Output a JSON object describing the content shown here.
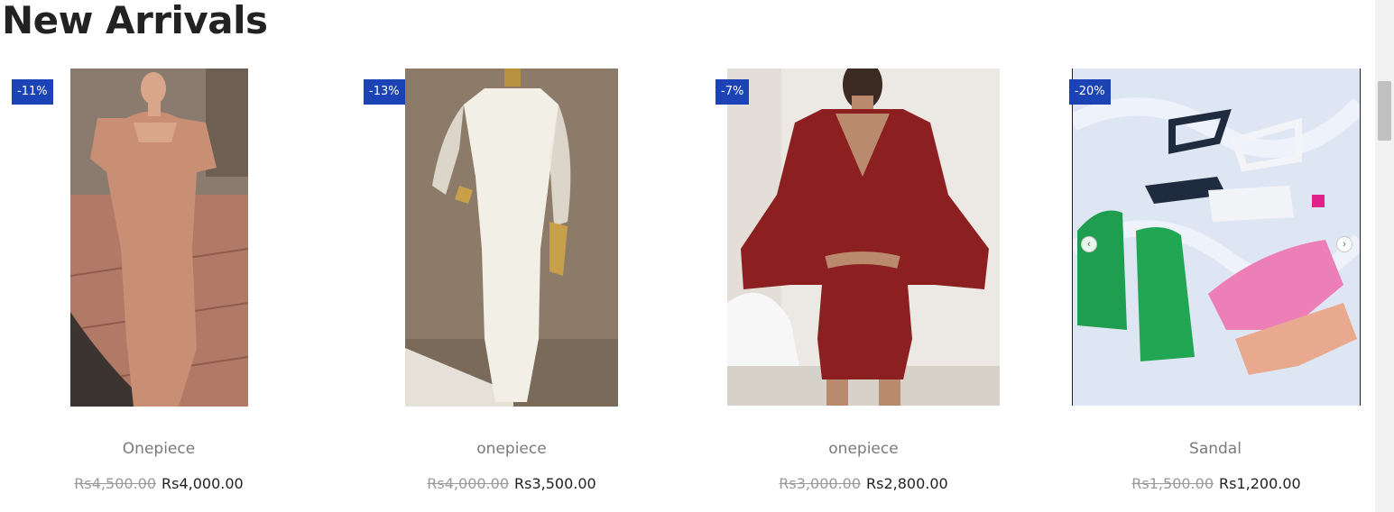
{
  "section": {
    "title": "New Arrivals"
  },
  "products": [
    {
      "name": "Onepiece",
      "discount": "-11%",
      "old_price": "Rs4,500.00",
      "new_price": "Rs4,000.00",
      "image": "satin-puff-sleeve-dress-photo"
    },
    {
      "name": "onepiece",
      "discount": "-13%",
      "old_price": "Rs4,000.00",
      "new_price": "Rs3,500.00",
      "image": "white-sheer-sleeve-dress-photo"
    },
    {
      "name": "onepiece",
      "discount": "-7%",
      "old_price": "Rs3,000.00",
      "new_price": "Rs2,800.00",
      "image": "red-wrap-dress-photo"
    },
    {
      "name": "Sandal",
      "discount": "-20%",
      "old_price": "Rs1,500.00",
      "new_price": "Rs1,200.00",
      "image": "strappy-sandals-photo"
    }
  ],
  "colors": {
    "badge": "#1b43b5",
    "title": "#222222",
    "product_name": "#7a7a7a",
    "old_price": "#9a9a9a"
  },
  "icons": {
    "prev": "chevron-left-icon",
    "next": "chevron-right-icon"
  }
}
